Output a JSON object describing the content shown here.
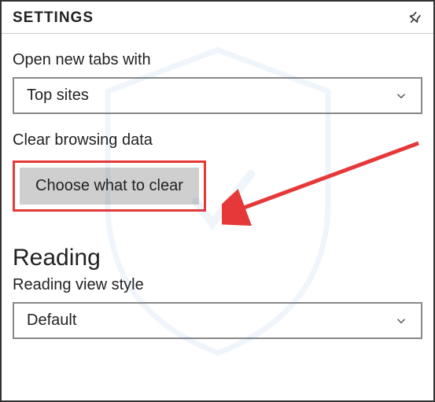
{
  "header": {
    "title": "SETTINGS"
  },
  "openTabs": {
    "label": "Open new tabs with",
    "selected": "Top sites"
  },
  "clearData": {
    "label": "Clear browsing data",
    "button": "Choose what to clear"
  },
  "reading": {
    "heading": "Reading",
    "styleLabel": "Reading view style",
    "selected": "Default"
  }
}
